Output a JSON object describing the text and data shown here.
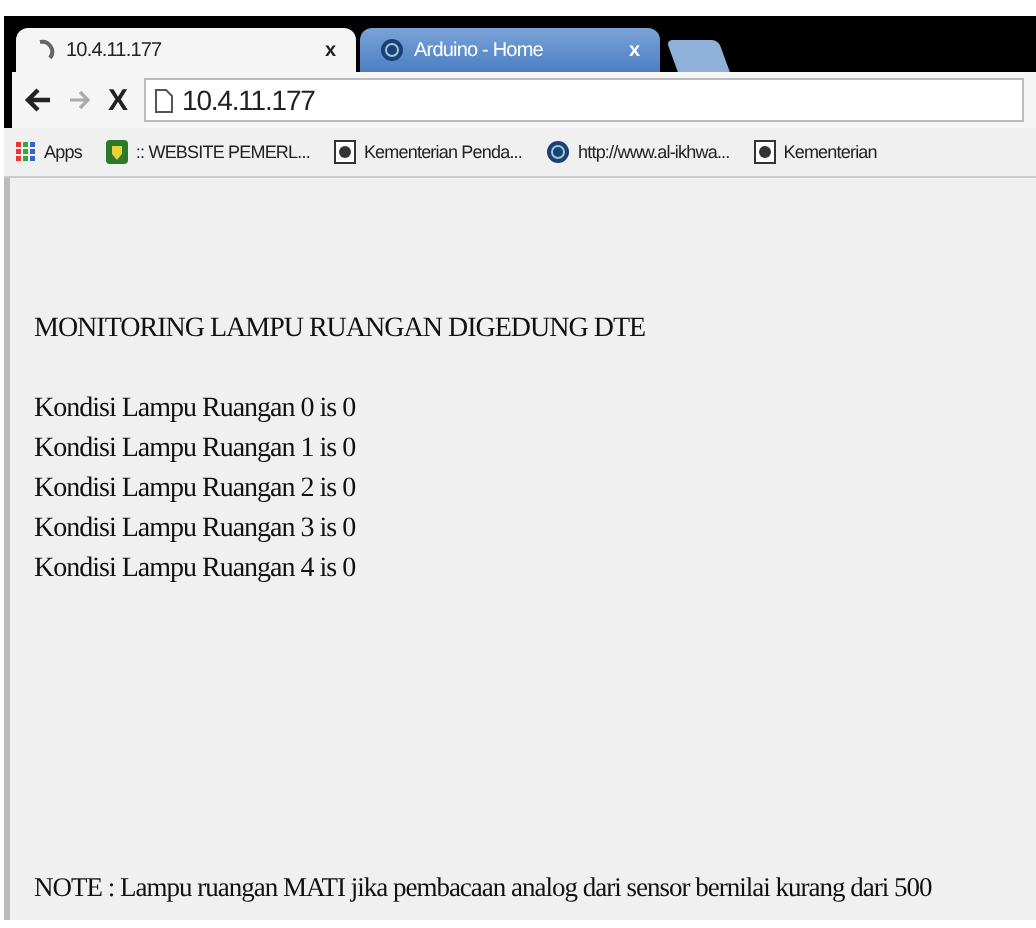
{
  "tabs": [
    {
      "label": "10.4.11.177",
      "kind": "spinner",
      "selected": true,
      "close": "x"
    },
    {
      "label": "Arduino - Home",
      "kind": "globe",
      "selected": false,
      "close": "x"
    }
  ],
  "toolbar": {
    "stop": "X",
    "address": "10.4.11.177"
  },
  "bookmarks": [
    {
      "label": "Apps",
      "kind": "apps"
    },
    {
      "label": ":: WEBSITE PEMERL...",
      "kind": "shield"
    },
    {
      "label": "Kementerian Penda...",
      "kind": "emblem"
    },
    {
      "label": "http://www.al-ikhwa...",
      "kind": "globe"
    },
    {
      "label": "Kementerian",
      "kind": "emblem"
    }
  ],
  "page": {
    "heading": "MONITORING LAMPU RUANGAN DIGEDUNG DTE",
    "lines": [
      "Kondisi Lampu Ruangan 0 is 0",
      "Kondisi Lampu Ruangan 1 is 0",
      "Kondisi Lampu Ruangan 2 is 0",
      "Kondisi Lampu Ruangan 3 is 0",
      "Kondisi Lampu Ruangan 4 is 0"
    ],
    "note": "NOTE : Lampu ruangan MATI jika pembacaan analog dari sensor bernilai kurang dari 500"
  }
}
